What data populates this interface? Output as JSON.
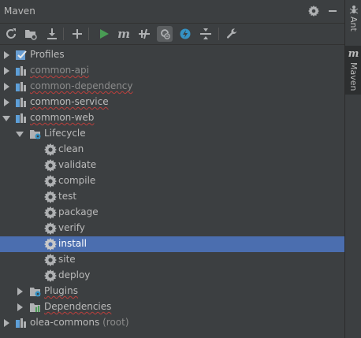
{
  "window": {
    "title": "Maven"
  },
  "toolbar": {
    "buttons": [
      {
        "name": "reimport-icon"
      },
      {
        "name": "generate-sources-icon"
      },
      {
        "name": "download-icon"
      },
      {
        "name": "add-icon"
      },
      {
        "name": "run-icon"
      },
      {
        "name": "maven-goal-icon",
        "glyph": "m"
      },
      {
        "name": "toggle-offline-icon"
      },
      {
        "name": "skip-tests-icon"
      },
      {
        "name": "show-dependencies-icon"
      },
      {
        "name": "collapse-all-icon"
      },
      {
        "name": "settings-wrench-icon"
      }
    ]
  },
  "tree": {
    "nodes": [
      {
        "label": "Profiles",
        "icon": "profiles",
        "muted": false,
        "squiggle": false
      },
      {
        "label": "common-api",
        "icon": "module",
        "muted": true,
        "squiggle": true
      },
      {
        "label": "common-dependency",
        "icon": "module",
        "muted": true,
        "squiggle": true
      },
      {
        "label": "common-service",
        "icon": "module",
        "muted": false,
        "squiggle": true
      },
      {
        "label": "common-web",
        "icon": "module",
        "muted": false,
        "squiggle": true
      },
      {
        "label": "Lifecycle",
        "icon": "folder-gear"
      },
      {
        "label": "clean",
        "icon": "gear"
      },
      {
        "label": "validate",
        "icon": "gear"
      },
      {
        "label": "compile",
        "icon": "gear"
      },
      {
        "label": "test",
        "icon": "gear"
      },
      {
        "label": "package",
        "icon": "gear"
      },
      {
        "label": "verify",
        "icon": "gear"
      },
      {
        "label": "install",
        "icon": "gear",
        "selected": true
      },
      {
        "label": "site",
        "icon": "gear"
      },
      {
        "label": "deploy",
        "icon": "gear"
      },
      {
        "label": "Plugins",
        "icon": "folder-gear",
        "squiggle": true
      },
      {
        "label": "Dependencies",
        "icon": "folder-chart",
        "squiggle": true
      },
      {
        "label": "olea-commons",
        "icon": "module",
        "suffix": "(root)"
      }
    ]
  },
  "side": {
    "tabs": [
      {
        "label": "Ant",
        "icon": "ant-icon"
      },
      {
        "label": "Maven",
        "icon": "m"
      }
    ]
  },
  "colors": {
    "background": "#3c3f41",
    "selection": "#4b6eaf",
    "text": "#bbbbbb",
    "run": "#499c54"
  }
}
